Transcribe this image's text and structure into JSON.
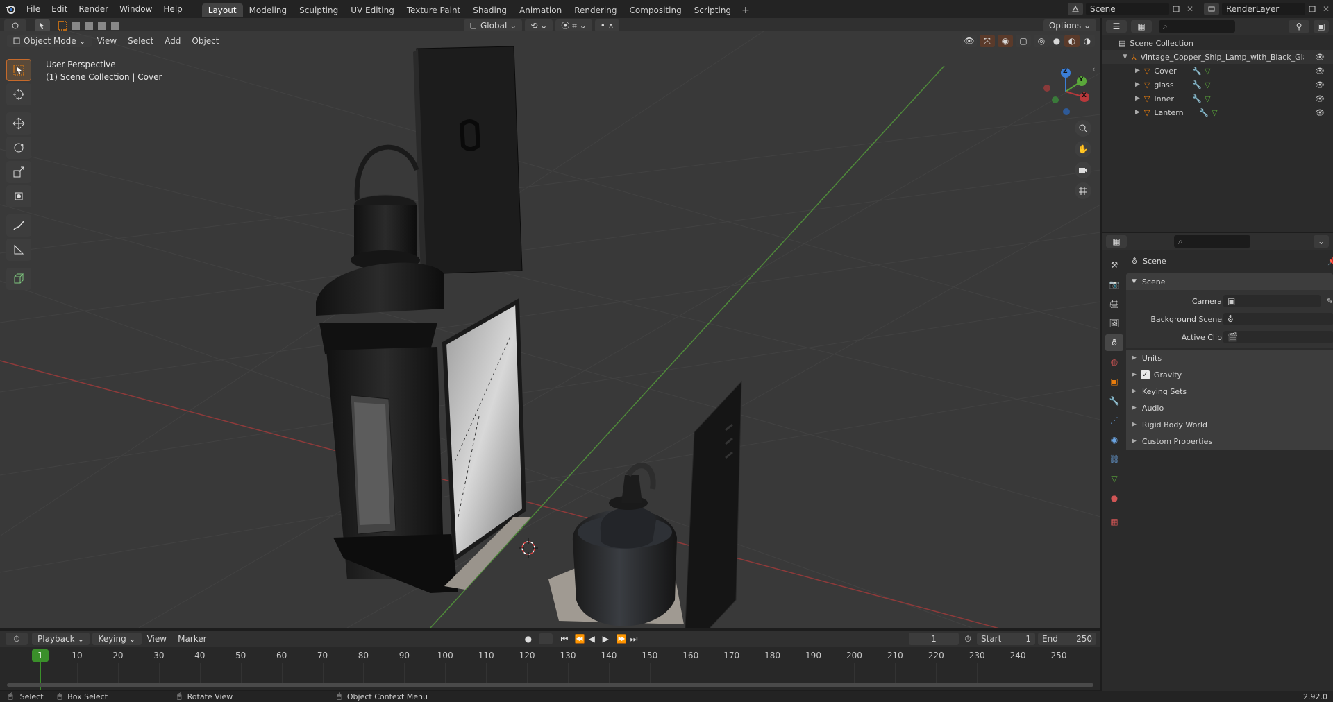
{
  "topbar": {
    "menus": [
      "File",
      "Edit",
      "Render",
      "Window",
      "Help"
    ],
    "workspaces": [
      "Layout",
      "Modeling",
      "Sculpting",
      "UV Editing",
      "Texture Paint",
      "Shading",
      "Animation",
      "Rendering",
      "Compositing",
      "Scripting"
    ],
    "active_workspace": "Layout",
    "add_tab": "+",
    "scene_name": "Scene",
    "view_layer": "RenderLayer"
  },
  "viewport_header": {
    "mode": "Object Mode",
    "menus": [
      "View",
      "Select",
      "Add",
      "Object"
    ],
    "orientation": "Global",
    "options_label": "Options"
  },
  "viewport": {
    "view_name": "User Perspective",
    "collection_info": "(1) Scene Collection | Cover",
    "axis_labels": {
      "x": "X",
      "y": "Y",
      "z": "Z"
    }
  },
  "outliner": {
    "root": "Scene Collection",
    "collection": "Vintage_Copper_Ship_Lamp_with_Black_Gla",
    "objects": [
      "Cover",
      "glass",
      "Inner",
      "Lantern"
    ]
  },
  "properties": {
    "context_title": "Scene",
    "panel_title": "Scene",
    "fields": [
      {
        "label": "Camera",
        "value": ""
      },
      {
        "label": "Background Scene",
        "value": ""
      },
      {
        "label": "Active Clip",
        "value": ""
      }
    ],
    "subpanels": [
      "Units",
      "Gravity",
      "Keying Sets",
      "Audio",
      "Rigid Body World",
      "Custom Properties"
    ],
    "gravity_checked": true
  },
  "timeline": {
    "menus": [
      "Playback",
      "Keying",
      "View",
      "Marker"
    ],
    "current_frame": "1",
    "start_label": "Start",
    "start_value": "1",
    "end_label": "End",
    "end_value": "250",
    "ticks": [
      "1",
      "10",
      "20",
      "30",
      "40",
      "50",
      "60",
      "70",
      "80",
      "90",
      "100",
      "110",
      "120",
      "130",
      "140",
      "150",
      "160",
      "170",
      "180",
      "190",
      "200",
      "210",
      "220",
      "230",
      "240",
      "250"
    ]
  },
  "statusbar": {
    "select": "Select",
    "box_select": "Box Select",
    "rotate_view": "Rotate View",
    "context_menu": "Object Context Menu",
    "version": "2.92.0"
  },
  "colors": {
    "accent_orange": "#e87d0d",
    "active_frame_green": "#3a8f2a",
    "x_axis": "#b8383b",
    "y_axis": "#5aa83a",
    "z_axis": "#3b7ed6"
  }
}
